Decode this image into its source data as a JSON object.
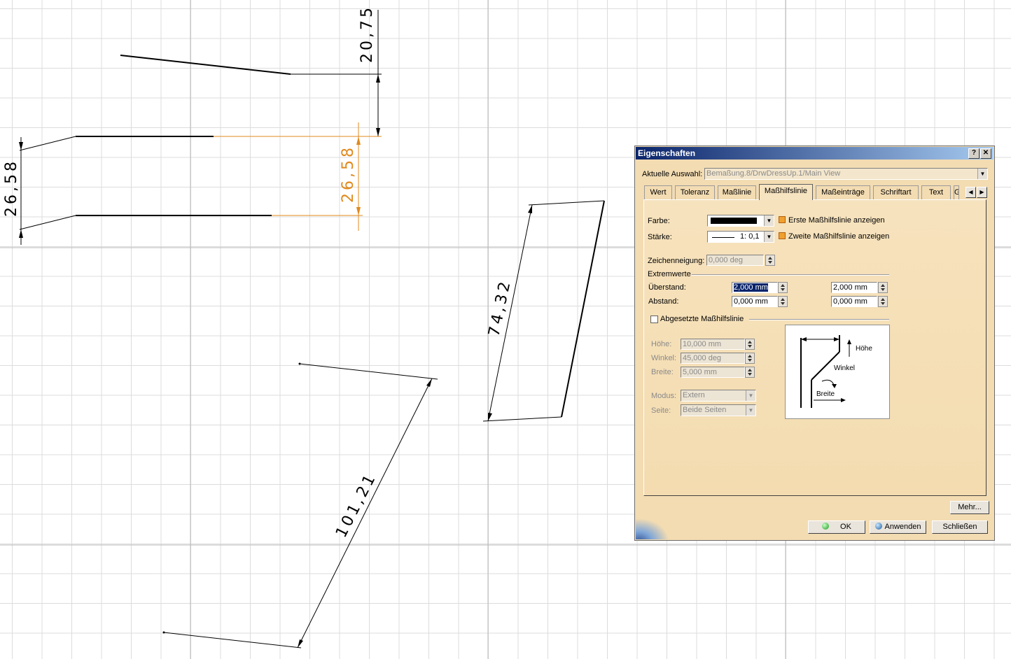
{
  "drawing": {
    "dimensions": {
      "dim_top_right": "20,75",
      "dim_left": "26,58",
      "dim_orange": "26,58",
      "dim_slanted": "74,32",
      "dim_long": "101,21"
    },
    "colors": {
      "line": "#000000",
      "selected": "#e08a1e",
      "grid": "#dcdcdc"
    }
  },
  "dialog": {
    "title": "Eigenschaften",
    "help_button": "?",
    "close_button": "✕",
    "current_selection_label": "Aktuelle Auswahl:",
    "current_selection_value": "Bemaßung.8/DrwDressUp.1/Main View",
    "tabs": [
      {
        "label": "Wert"
      },
      {
        "label": "Toleranz"
      },
      {
        "label": "Maßlinie"
      },
      {
        "label": "Maßhilfslinie",
        "active": true
      },
      {
        "label": "Maßeinträge"
      },
      {
        "label": "Schriftart"
      },
      {
        "label": "Text"
      },
      {
        "label": "G"
      }
    ],
    "color_label": "Farbe:",
    "color_value": "#000000",
    "thickness_label": "Stärke:",
    "thickness_value": "1: 0,1",
    "show_first_label": "Erste Maßhilfslinie anzeigen",
    "show_first_checked": true,
    "show_second_label": "Zweite Maßhilfslinie anzeigen",
    "show_second_checked": true,
    "slant_label": "Zeichenneigung:",
    "slant_value": "0,000 deg",
    "extremes_label": "Extremwerte",
    "overrun_label": "Überstand:",
    "overrun_1": "2,000 mm",
    "overrun_2": "2,000 mm",
    "gap_label": "Abstand:",
    "gap_1": "0,000 mm",
    "gap_2": "0,000 mm",
    "offset_label": "Abgesetzte Maßhilfslinie",
    "offset_checked": false,
    "height_label": "Höhe:",
    "height_value": "10,000 mm",
    "angle_label": "Winkel:",
    "angle_value": "45,000 deg",
    "width_label": "Breite:",
    "width_value": "5,000 mm",
    "mode_label": "Modus:",
    "mode_value": "Extern",
    "side_label": "Seite:",
    "side_value": "Beide Seiten",
    "preview": {
      "hoehe": "Höhe",
      "winkel": "Winkel",
      "breite": "Breite"
    },
    "more_button": "Mehr...",
    "ok_button": "OK",
    "apply_button": "Anwenden",
    "close_dialog_button": "Schließen"
  }
}
